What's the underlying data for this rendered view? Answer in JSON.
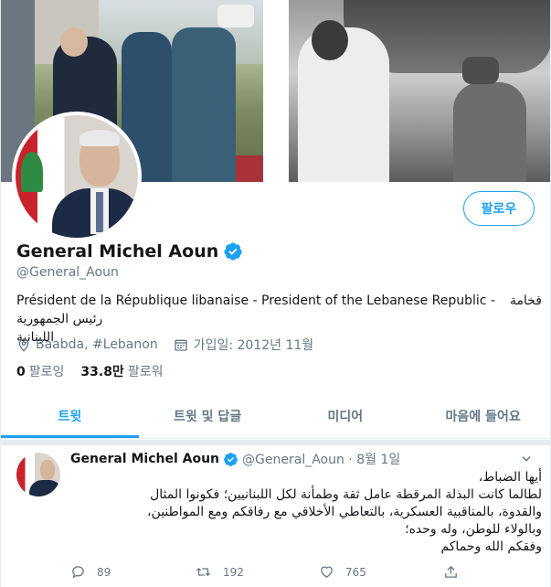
{
  "profile": {
    "follow_label": "팔로우",
    "name": "General Michel Aoun",
    "handle": "@General_Aoun",
    "bio_line1_left": "Président de la République libanaise - President of the Lebanese Republic -",
    "bio_line1_right": "فخامة",
    "bio_line2": "رئيس الجمهورية اللبنانية",
    "location": "Baabda, #Lebanon",
    "joined": "가입일: 2012년 11월",
    "following_count": "0",
    "following_label": "팔로잉",
    "followers_count": "33.8만",
    "followers_label": "팔로워"
  },
  "tabs": [
    {
      "label": "트윗"
    },
    {
      "label": "트윗 및 답글"
    },
    {
      "label": "미디어"
    },
    {
      "label": "마음에 들어요"
    }
  ],
  "tweet": {
    "name": "General Michel Aoun",
    "meta": "@General_Aoun · 8월 1일",
    "lines": [
      "أيها الضباط،",
      "لطالما كانت البذلة المرقطة عامل ثقة وطمأنة لكل اللبنانيين؛ فكونوا المثال",
      "والقدوة، بالمناقبية العسكرية، بالتعاطي الأخلاقي مع رفاقكم ومع المواطنين،",
      "وبالولاء للوطن، وله وحده؛",
      "وفقكم الله وحماكم"
    ],
    "replies": "89",
    "retweets": "192",
    "likes": "765"
  },
  "icons": {
    "verified": "verified-badge-icon",
    "location": "location-pin-icon",
    "calendar": "calendar-icon",
    "reply": "reply-icon",
    "retweet": "retweet-icon",
    "like": "heart-icon",
    "share": "share-icon",
    "caret": "chevron-down-icon"
  },
  "colors": {
    "accent": "#1da1f2",
    "secondary_text": "#657786",
    "primary_text": "#14171a"
  }
}
